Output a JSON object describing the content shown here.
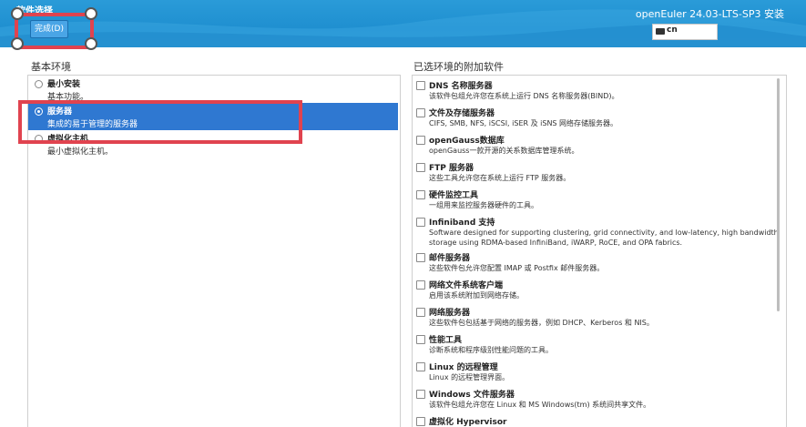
{
  "header": {
    "title": "软件选择",
    "done_button": "完成(D)",
    "install_title": "openEuler 24.03-LTS-SP3 安装",
    "keyboard": "cn"
  },
  "left": {
    "heading": "基本环境",
    "environments": [
      {
        "name": "最小安装",
        "desc": "基本功能。",
        "selected": false
      },
      {
        "name": "服务器",
        "desc": "集成的易于管理的服务器",
        "selected": true
      },
      {
        "name": "虚拟化主机",
        "desc": "最小虚拟化主机。",
        "selected": false
      }
    ]
  },
  "right": {
    "heading": "已选环境的附加软件",
    "addons": [
      {
        "name": "DNS 名称服务器",
        "desc": "该软件包组允许您在系统上运行 DNS 名称服务器(BIND)。"
      },
      {
        "name": "文件及存储服务器",
        "desc": "CIFS, SMB, NFS, iSCSI, iSER 及 iSNS 网络存储服务器。"
      },
      {
        "name": "openGauss数据库",
        "desc": "openGauss一款开源的关系数据库管理系统。"
      },
      {
        "name": "FTP 服务器",
        "desc": "这些工具允许您在系统上运行 FTP 服务器。"
      },
      {
        "name": "硬件监控工具",
        "desc": "一组用来监控服务器硬件的工具。"
      },
      {
        "name": "Infiniband 支持",
        "desc": "Software designed for supporting clustering, grid connectivity, and low-latency, high bandwidth storage using RDMA-based InfiniBand, iWARP, RoCE, and OPA fabrics."
      },
      {
        "name": "邮件服务器",
        "desc": "这些软件包允许您配置 IMAP 或 Postfix 邮件服务器。"
      },
      {
        "name": "网络文件系统客户端",
        "desc": "启用该系统附加到网络存储。"
      },
      {
        "name": "网络服务器",
        "desc": "这些软件包包括基于网络的服务器，例如 DHCP、Kerberos 和 NIS。"
      },
      {
        "name": "性能工具",
        "desc": "诊断系统和程序级别性能问题的工具。"
      },
      {
        "name": "Linux 的远程管理",
        "desc": "Linux 的远程管理界面。"
      },
      {
        "name": "Windows 文件服务器",
        "desc": "该软件包组允许您在 Linux 和 MS Windows(tm) 系统间共享文件。"
      },
      {
        "name": "虚拟化 Hypervisor",
        "desc": ""
      }
    ]
  },
  "colors": {
    "header_blue": "#2493d2",
    "selection_blue": "#2f78d1",
    "annotation_red": "#e0434f"
  }
}
